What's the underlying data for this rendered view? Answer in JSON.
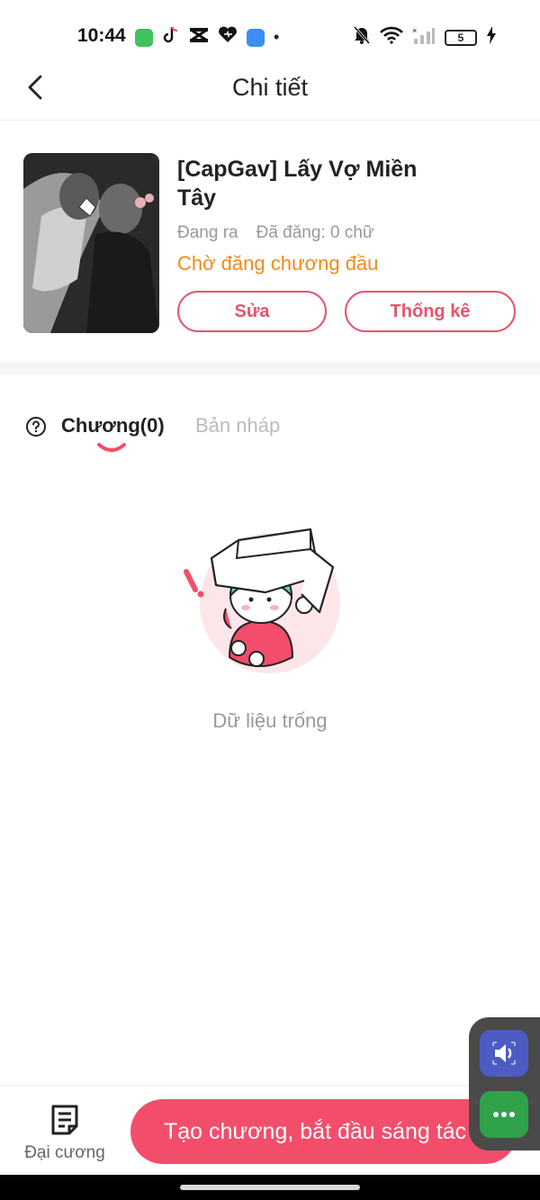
{
  "status_bar": {
    "time": "10:44",
    "battery": "5",
    "dot": "•"
  },
  "header": {
    "title": "Chi tiết"
  },
  "book": {
    "title": "[CapGav] Lấy Vợ Miền Tây",
    "state": "Đang ra",
    "word_count": "Đã đăng: 0 chữ",
    "publish_status": "Chờ đăng chương đầu",
    "edit_label": "Sửa",
    "stats_label": "Thống kê"
  },
  "tabs": [
    {
      "label": "Chương(0)",
      "active": true
    },
    {
      "label": "Bản nháp",
      "active": false
    }
  ],
  "empty_state": {
    "text": "Dữ liệu trống"
  },
  "bottom_bar": {
    "outline_label": "Đại cương",
    "create_label": "Tạo chương, bắt đầu sáng tác"
  },
  "colors": {
    "accent": "#f24e6b",
    "outline_accent": "#e8536b",
    "status_orange": "#f08a1c",
    "float_blue": "#4e5bc3",
    "float_green": "#2fa24a"
  },
  "icons": [
    "back-arrow-icon",
    "help-icon",
    "outline-document-icon",
    "volume-icon",
    "more-dots-icon",
    "empty-box-illustration"
  ]
}
